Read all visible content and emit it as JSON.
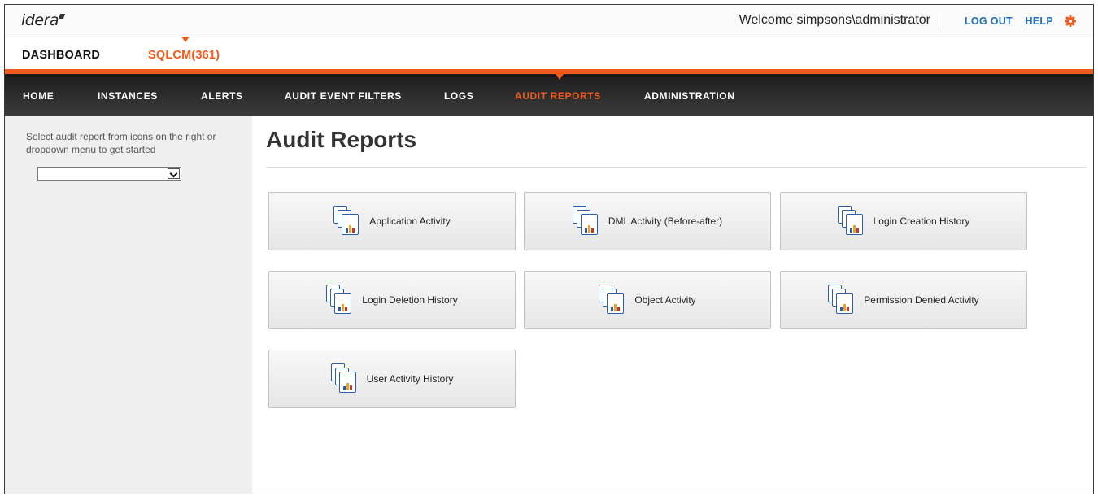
{
  "header": {
    "logo": "idera",
    "welcome": "Welcome simpsons\\administrator",
    "logout": "LOG OUT",
    "help": "HELP",
    "gear_icon": "gear-icon",
    "accent": "#f05a1d",
    "link_color": "#1f6fbf"
  },
  "subnav": {
    "dashboard": "DASHBOARD",
    "sqlcm": "SQLCM(361)"
  },
  "nav": {
    "items": [
      "HOME",
      "INSTANCES",
      "ALERTS",
      "AUDIT EVENT FILTERS",
      "LOGS",
      "AUDIT REPORTS",
      "ADMINISTRATION"
    ],
    "active": "AUDIT REPORTS"
  },
  "sidebar": {
    "instruction": "Select audit report from icons on the right or dropdown menu to get started",
    "dropdown_value": ""
  },
  "main": {
    "title": "Audit Reports",
    "reports": [
      {
        "label": "Application Activity",
        "icon": "report-icon"
      },
      {
        "label": "DML Activity (Before-after)",
        "icon": "report-icon"
      },
      {
        "label": "Login Creation History",
        "icon": "report-icon"
      },
      {
        "label": "Login Deletion History",
        "icon": "report-icon"
      },
      {
        "label": "Object Activity",
        "icon": "report-icon"
      },
      {
        "label": "Permission Denied Activity",
        "icon": "report-icon"
      },
      {
        "label": "User Activity History",
        "icon": "report-icon"
      }
    ]
  }
}
